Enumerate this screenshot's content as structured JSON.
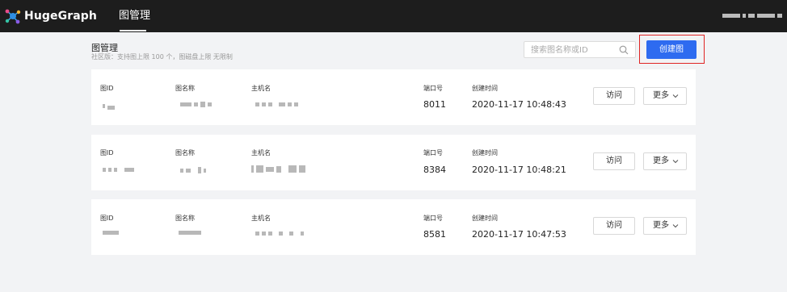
{
  "app": {
    "brand": "HugeGraph",
    "nav_tab": "图管理"
  },
  "header": {
    "title": "图管理",
    "subtitle": "社区版：支持图上限 100 个，图磁盘上限 无限制",
    "search_placeholder": "搜索图名称或ID",
    "create_button": "创建图",
    "create_highlight_color": "#e02424",
    "accent_color": "#2e6bf0"
  },
  "labels": {
    "graph_id": "图ID",
    "graph_name": "图名称",
    "host": "主机名",
    "port": "端口号",
    "created": "创建时间",
    "visit": "访问",
    "more": "更多"
  },
  "graphs": [
    {
      "port": "8011",
      "created": "2020-11-17 10:48:43"
    },
    {
      "port": "8384",
      "created": "2020-11-17 10:48:21"
    },
    {
      "port": "8581",
      "created": "2020-11-17 10:47:53"
    }
  ]
}
